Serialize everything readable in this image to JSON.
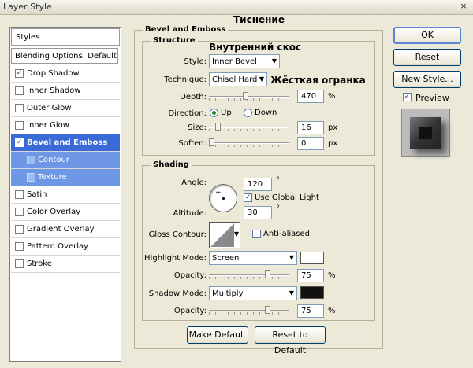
{
  "window": {
    "title": "Layer Style",
    "close": "×"
  },
  "styles_panel": {
    "header": "Styles",
    "blending": "Blending Options: Default",
    "items": [
      {
        "label": "Drop Shadow",
        "checked": true
      },
      {
        "label": "Inner Shadow",
        "checked": false
      },
      {
        "label": "Outer Glow",
        "checked": false
      },
      {
        "label": "Inner Glow",
        "checked": false
      },
      {
        "label": "Bevel and Emboss",
        "checked": true
      },
      {
        "label": "Contour",
        "checked": false
      },
      {
        "label": "Texture",
        "checked": false
      },
      {
        "label": "Satin",
        "checked": false
      },
      {
        "label": "Color Overlay",
        "checked": false
      },
      {
        "label": "Gradient Overlay",
        "checked": false
      },
      {
        "label": "Pattern Overlay",
        "checked": false
      },
      {
        "label": "Stroke",
        "checked": false
      }
    ]
  },
  "bevel": {
    "title": "Bevel and Emboss",
    "structure_title": "Structure",
    "style_label": "Style:",
    "style_value": "Inner Bevel",
    "technique_label": "Technique:",
    "technique_value": "Chisel Hard",
    "depth_label": "Depth:",
    "depth_value": "470",
    "depth_unit": "%",
    "direction_label": "Direction:",
    "dir_up": "Up",
    "dir_down": "Down",
    "size_label": "Size:",
    "size_value": "16",
    "size_unit": "px",
    "soften_label": "Soften:",
    "soften_value": "0",
    "soften_unit": "px"
  },
  "shading": {
    "title": "Shading",
    "angle_label": "Angle:",
    "angle_value": "120",
    "deg": "°",
    "global_light": "Use Global Light",
    "altitude_label": "Altitude:",
    "altitude_value": "30",
    "gloss_label": "Gloss Contour:",
    "anti_aliased": "Anti-aliased",
    "highlight_label": "Highlight Mode:",
    "highlight_value": "Screen",
    "highlight_opacity_label": "Opacity:",
    "highlight_opacity_value": "75",
    "shadow_label": "Shadow Mode:",
    "shadow_value": "Multiply",
    "shadow_opacity_label": "Opacity:",
    "shadow_opacity_value": "75",
    "pct": "%"
  },
  "buttons": {
    "make_default": "Make Default",
    "reset_default": "Reset to Default",
    "ok": "OK",
    "reset": "Reset",
    "new_style": "New Style...",
    "preview": "Preview"
  },
  "annotations": {
    "emboss": "Тиснение",
    "inner_bevel": "Внутренний скос",
    "chisel_hard": "Жёсткая огранка"
  },
  "colors": {
    "highlight_color": "#ffffff",
    "shadow_color": "#111111",
    "selection": "#3a6ad6"
  },
  "sliders": {
    "depth": 0.45,
    "size": 0.08,
    "soften": 0.0,
    "highlight_opacity": 0.75,
    "shadow_opacity": 0.75
  }
}
